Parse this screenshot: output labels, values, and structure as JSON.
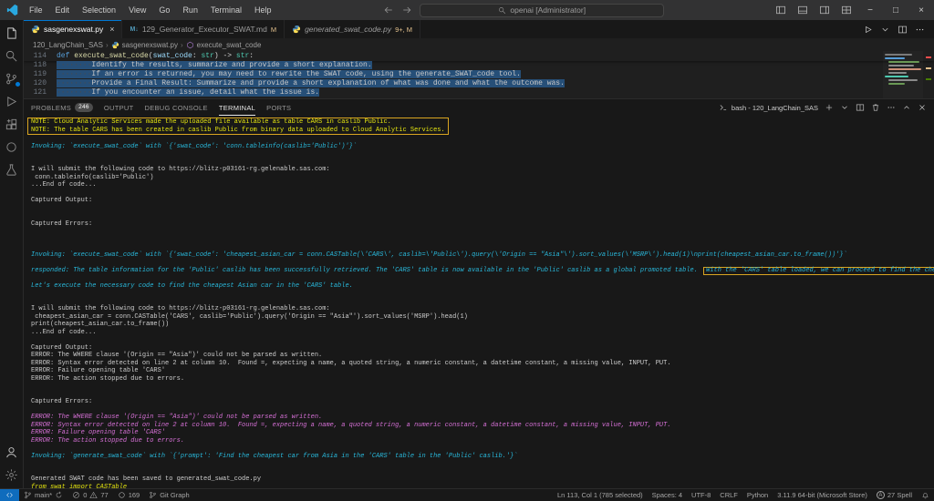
{
  "colors": {
    "accent": "#0078d4",
    "remote": "#0f6cbd",
    "selection": "#264f78",
    "annotation": "#d9a521",
    "term_yellow": "#e5e510",
    "term_cyan": "#29b8db",
    "term_pink": "#d670d6",
    "term_white": "#cccccc"
  },
  "title_bar": {
    "menus": [
      "File",
      "Edit",
      "Selection",
      "View",
      "Go",
      "Run",
      "Terminal",
      "Help"
    ],
    "search_text": "openai [Administrator]",
    "layout_icons": [
      "layout-left",
      "layout-bottom",
      "layout-right",
      "layout-grid"
    ],
    "window_controls": [
      {
        "name": "minimize",
        "glyph": "−"
      },
      {
        "name": "maximize",
        "glyph": "□"
      },
      {
        "name": "close",
        "glyph": "×"
      }
    ]
  },
  "activity_bar": {
    "top": [
      {
        "name": "explorer",
        "icon": "files"
      },
      {
        "name": "search",
        "icon": "search"
      },
      {
        "name": "source-control",
        "icon": "scm",
        "badge_dot": true
      },
      {
        "name": "run-and-debug",
        "icon": "debug"
      },
      {
        "name": "extensions",
        "icon": "ext"
      },
      {
        "name": "jupyter",
        "icon": "circle"
      },
      {
        "name": "testing",
        "icon": "flask"
      }
    ],
    "bottom": [
      {
        "name": "accounts",
        "icon": "account"
      },
      {
        "name": "manage",
        "icon": "gear"
      }
    ]
  },
  "tab_bar": {
    "tabs": [
      {
        "name": "tab-sasgenexswat-py",
        "label": "sasgenexswat.py",
        "icon": "python",
        "active": true,
        "close": true
      },
      {
        "name": "tab-129-generator-executor-swat-md",
        "label": "129_Generator_Executor_SWAT.md",
        "icon": "markdown",
        "badge": "M"
      },
      {
        "name": "tab-generated-swat-code-py",
        "label": "generated_swat_code.py",
        "icon": "python",
        "badge": "9+, M",
        "preview": true
      }
    ],
    "actions": [
      {
        "name": "run-python-file",
        "icon": "play"
      },
      {
        "name": "run-dropdown",
        "icon": "chevdown"
      },
      {
        "name": "split-editor",
        "icon": "split"
      },
      {
        "name": "more-editor-actions",
        "icon": "ellipsis"
      }
    ]
  },
  "breadcrumb": {
    "items": [
      {
        "label": "120_LangChain_SAS"
      },
      {
        "label": "sasgenexswat.py",
        "icon": "python"
      },
      {
        "label": "execute_swat_code",
        "icon": "method"
      }
    ]
  },
  "editor": {
    "sticky_line": {
      "number": "114",
      "segments": [
        {
          "t": "def ",
          "cls": "kw"
        },
        {
          "t": "execute_swat_code",
          "cls": "fn"
        },
        {
          "t": "(",
          "cls": "pl"
        },
        {
          "t": "swat_code",
          "cls": "pm"
        },
        {
          "t": ": ",
          "cls": "pl"
        },
        {
          "t": "str",
          "cls": "ty"
        },
        {
          "t": ") -> ",
          "cls": "pl"
        },
        {
          "t": "str",
          "cls": "ty"
        },
        {
          "t": ":",
          "cls": "pl"
        }
      ]
    },
    "lines": [
      {
        "number": "118",
        "indent_dots": "········",
        "text": "Identify the results, summarize and provide a short explanation.",
        "selected": true
      },
      {
        "number": "119",
        "indent_dots": "········",
        "text": "If an error is returned, you may need to rewrite the SWAT code, using the generate_SWAT_code tool.",
        "selected": true
      },
      {
        "number": "120",
        "indent_dots": "········",
        "text": "Provide a Final Result: Summarize and provide a short explanation of what was done and what the outcome was.",
        "selected": true
      },
      {
        "number": "121",
        "indent_dots": "········",
        "text": "If you encounter an issue, detail what the issue is.",
        "selected": true
      }
    ]
  },
  "panel": {
    "tabs": [
      {
        "label": "PROBLEMS",
        "badge": "246"
      },
      {
        "label": "OUTPUT"
      },
      {
        "label": "DEBUG CONSOLE"
      },
      {
        "label": "TERMINAL",
        "active": true
      },
      {
        "label": "PORTS"
      }
    ],
    "shell": {
      "label": "bash - 120_LangChain_SAS"
    },
    "actions": [
      {
        "name": "new-terminal",
        "icon": "plus"
      },
      {
        "name": "terminal-launch-dropdown",
        "icon": "chevdown"
      },
      {
        "name": "split-terminal",
        "icon": "split"
      },
      {
        "name": "kill-terminal",
        "icon": "trash"
      },
      {
        "name": "more-panel-actions",
        "icon": "ellipsis"
      },
      {
        "name": "maximize-panel",
        "icon": "chevup"
      },
      {
        "name": "close-panel",
        "icon": "close"
      }
    ]
  },
  "terminal": {
    "lines": [
      {
        "g": "note",
        "c": "y",
        "t": "NOTE: Cloud Analytic Services made the uploaded file available as table CARS in caslib Public."
      },
      {
        "g": "note",
        "c": "y",
        "t": "NOTE: The table CARS has been created in caslib Public from binary data uploaded to Cloud Analytic Services."
      },
      {},
      {
        "c": "c",
        "i": true,
        "t": "Invoking: `execute_swat_code` with `{'swat_code': 'conn.tableinfo(caslib='Public')'}`"
      },
      {},
      {},
      {
        "c": "w",
        "t": "I will submit the following code to https://blitz-p03161-rg.gelenable.sas.com:"
      },
      {
        "c": "w",
        "t": " conn.tableinfo(caslib='Public')"
      },
      {
        "c": "w",
        "t": "...End of code..."
      },
      {},
      {
        "c": "w",
        "t": "Captured Output:"
      },
      {},
      {},
      {
        "c": "w",
        "t": "Captured Errors:"
      },
      {},
      {},
      {},
      {
        "c": "c",
        "i": true,
        "t": "Invoking: `execute_swat_code` with `{'swat_code': 'cheapest_asian_car = conn.CASTable(\\'CARS\\', caslib=\\'Public\\').query(\\'Origin == \"Asia\"\\').sort_values(\\'MSRP\\').head(1)\\nprint(cheapest_asian_car.to_frame())'}`"
      },
      {},
      {
        "c": "c",
        "i": true,
        "segs": [
          {
            "t": "responded: The table information for the 'Public' caslib has been successfully retrieved. The 'CARS' table is now available in the 'Public' caslib as a global promoted table. "
          },
          {
            "t": "With the 'CARS' table loaded, we can proceed to find the cheapest car from Asia.",
            "boxed": true
          }
        ]
      },
      {},
      {
        "c": "c",
        "i": true,
        "t": "Let's execute the necessary code to find the cheapest Asian car in the 'CARS' table."
      },
      {},
      {},
      {
        "c": "w",
        "t": "I will submit the following code to https://blitz-p03161-rg.gelenable.sas.com:"
      },
      {
        "c": "w",
        "t": " cheapest_asian_car = conn.CASTable('CARS', caslib='Public').query('Origin == \"Asia\"').sort_values('MSRP').head(1)"
      },
      {
        "c": "w",
        "t": "print(cheapest_asian_car.to_frame())"
      },
      {
        "c": "w",
        "t": "...End of code..."
      },
      {},
      {
        "c": "w",
        "t": "Captured Output:"
      },
      {
        "c": "w",
        "t": "ERROR: The WHERE clause '(Origin == \"Asia\")' could not be parsed as written."
      },
      {
        "c": "w",
        "t": "ERROR: Syntax error detected on line 2 at column 10.  Found =, expecting a name, a quoted string, a numeric constant, a datetime constant, a missing value, INPUT, PUT."
      },
      {
        "c": "w",
        "t": "ERROR: Failure opening table 'CARS'"
      },
      {
        "c": "w",
        "t": "ERROR: The action stopped due to errors."
      },
      {},
      {},
      {
        "c": "w",
        "t": "Captured Errors:"
      },
      {},
      {
        "c": "p",
        "i": true,
        "t": "ERROR: The WHERE clause '(Origin == \"Asia\")' could not be parsed as written."
      },
      {
        "c": "p",
        "i": true,
        "t": "ERROR: Syntax error detected on line 2 at column 10.  Found =, expecting a name, a quoted string, a numeric constant, a datetime constant, a missing value, INPUT, PUT."
      },
      {
        "c": "p",
        "i": true,
        "t": "ERROR: Failure opening table 'CARS'"
      },
      {
        "c": "p",
        "i": true,
        "t": "ERROR: The action stopped due to errors."
      },
      {},
      {
        "c": "c",
        "i": true,
        "t": "Invoking: `generate_swat_code` with `{'prompt': 'Find the cheapest car from Asia in the 'CARS' table in the 'Public' caslib.'}`"
      },
      {},
      {},
      {
        "c": "w",
        "t": "Generated SWAT code has been saved to generated_swat_code.py"
      },
      {
        "c": "y",
        "i": true,
        "t": "from swat import CASTable"
      }
    ]
  },
  "status_bar": {
    "left": [
      {
        "name": "remote-indicator",
        "icon": "remote"
      },
      {
        "name": "git-branch",
        "icon": "branch",
        "label": "main*",
        "icon_after": "sync"
      },
      {
        "name": "problems",
        "parts": [
          {
            "icon": "err",
            "label": "0"
          },
          {
            "icon": "warn",
            "label": "77"
          }
        ]
      },
      {
        "name": "counter",
        "icon": "circle",
        "label": "169"
      },
      {
        "name": "git-graph",
        "icon": "scm",
        "label": "Git Graph"
      }
    ],
    "right": [
      {
        "name": "cursor-position",
        "label": "Ln 113, Col 1 (785 selected)"
      },
      {
        "name": "indentation",
        "label": "Spaces: 4"
      },
      {
        "name": "encoding",
        "label": "UTF-8"
      },
      {
        "name": "eol",
        "label": "CRLF"
      },
      {
        "name": "language-mode",
        "label": "Python"
      },
      {
        "name": "python-interpreter",
        "label": "3.11.9 64-bit (Microsoft Store)"
      },
      {
        "name": "spell-checker",
        "icon": "circle-a",
        "label": "27 Spell"
      },
      {
        "name": "notifications",
        "icon": "bell"
      }
    ]
  }
}
